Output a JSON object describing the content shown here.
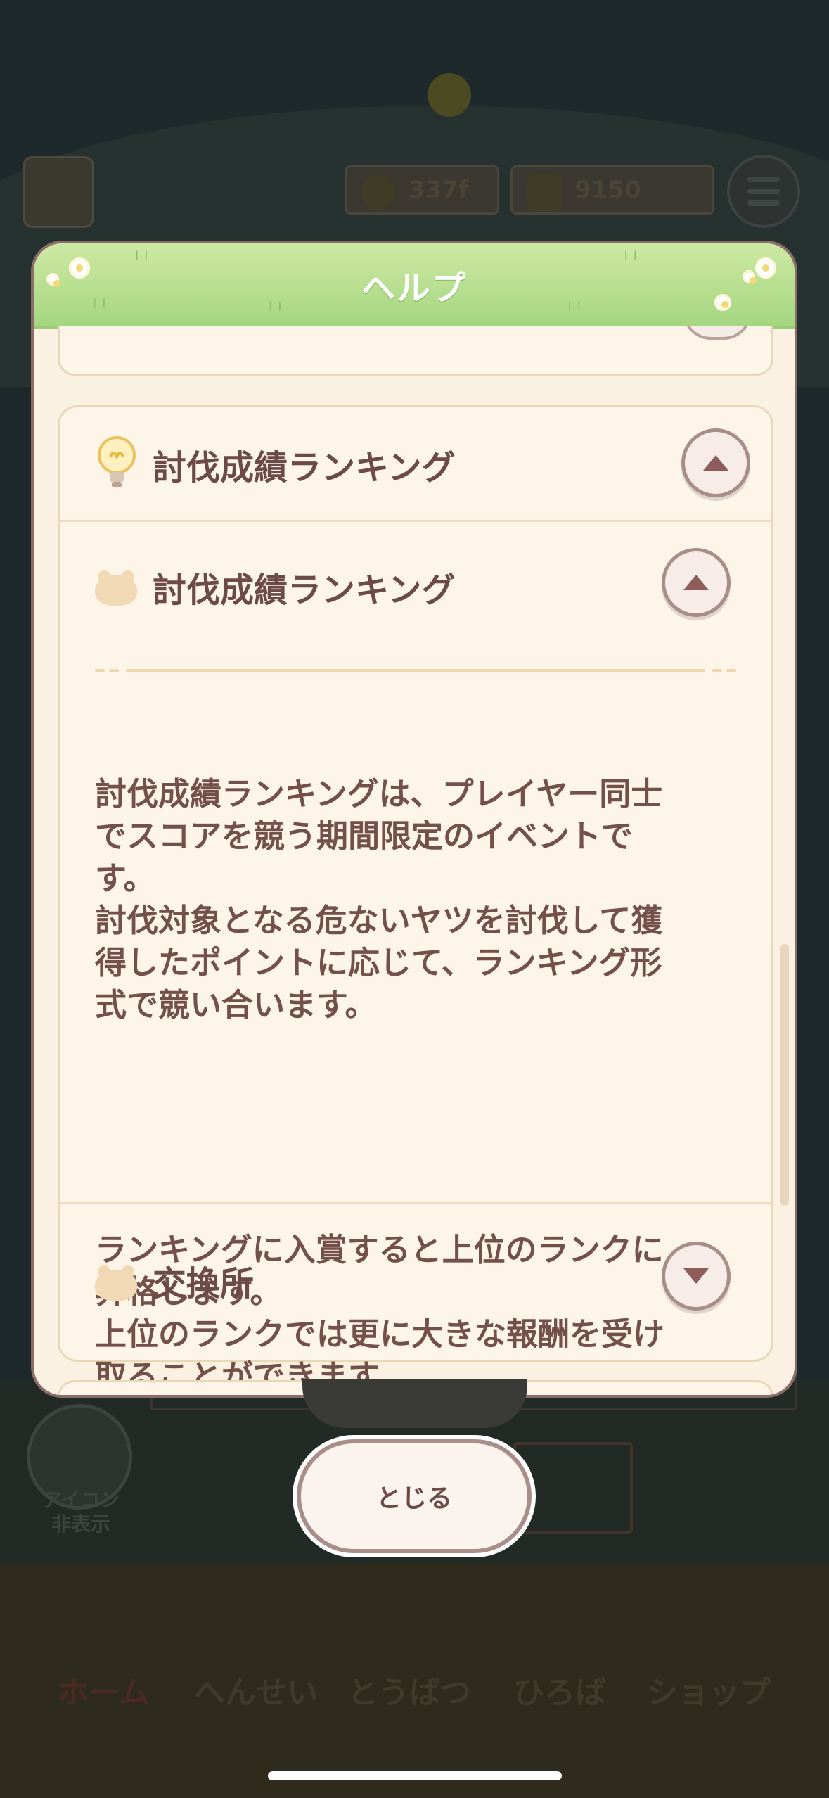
{
  "background": {
    "currency": {
      "coins": "337f",
      "gems": "9150"
    },
    "icon_toggle_label": "アイコン\n非表示",
    "nav": [
      "ホーム",
      "へんせい",
      "とうばつ",
      "ひろば",
      "ショップ"
    ]
  },
  "modal": {
    "title": "ヘルプ",
    "section": {
      "title": "討伐成績ランキング",
      "subsection_title": "討伐成績ランキング",
      "paragraph1": "討伐成績ランキングは、プレイヤー同士\nでスコアを競う期間限定のイベントで\nす。\n討伐対象となる危ないヤツを討伐して獲\n得したポイントに応じて、ランキング形\n式で競い合います。",
      "paragraph2": "ランキングに入賞すると上位のランクに\n昇格します。\n上位のランクでは更に大きな報酬を受け\n取ることができます。",
      "next_subsection_title": "交換所"
    },
    "close_label": "とじる"
  },
  "colors": {
    "header_green": "#a5d680",
    "panel_cream": "#fbf1e2",
    "text_brown": "#6b4a47",
    "button_border": "#a88d89"
  },
  "icons": {
    "section": "lightbulb-icon",
    "subsection": "hamburger-bun-icon",
    "collapse": "triangle-up-icon",
    "expand": "triangle-down-icon"
  }
}
